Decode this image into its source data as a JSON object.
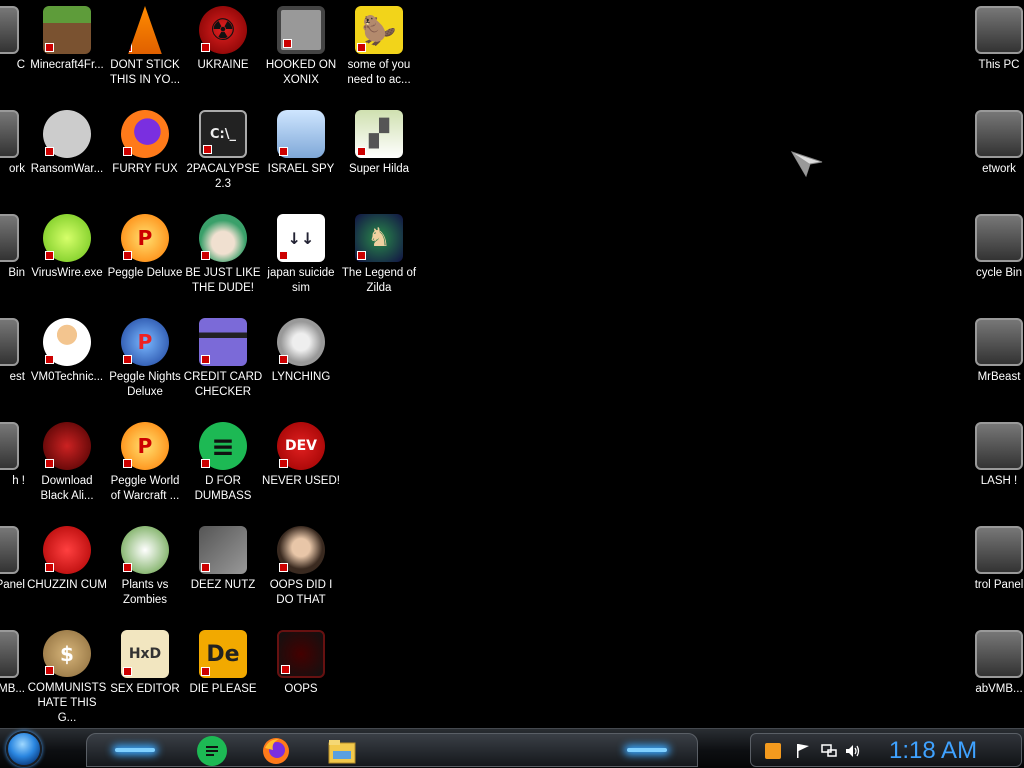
{
  "desktop": {
    "left_edge_labels": [
      "C",
      "ork",
      "Bin",
      "est",
      "h !",
      "Panel",
      "VMB..."
    ],
    "right_edge_labels": [
      "This PC",
      "etwork",
      "cycle Bin",
      "MrBeast",
      "LASH !",
      "trol Panel",
      "abVMB..."
    ],
    "columns": [
      [
        {
          "label": "Minecraft4Fr...",
          "icon": "minecraft-block-icon"
        },
        {
          "label": "RansomWar...",
          "icon": "skull-icon"
        },
        {
          "label": "VirusWire.exe",
          "icon": "lime-icon"
        },
        {
          "label": "VM0Technic...",
          "icon": "technician-icon"
        },
        {
          "label": "Download Black Ali...",
          "icon": "alien-icon"
        },
        {
          "label": "CHUZZIN CUM",
          "icon": "chuzzle-icon"
        },
        {
          "label": "COMMUNISTS HATE THIS G...",
          "icon": "money-bag-icon"
        }
      ],
      [
        {
          "label": "DONT STICK THIS IN YO...",
          "icon": "traffic-cone-icon"
        },
        {
          "label": "FURRY FUX",
          "icon": "firefox-icon"
        },
        {
          "label": "Peggle Deluxe",
          "icon": "peggle-icon"
        },
        {
          "label": "Peggle Nights Deluxe",
          "icon": "peggle-nights-icon"
        },
        {
          "label": "Peggle World of Warcraft ...",
          "icon": "peggle-wow-icon"
        },
        {
          "label": "Plants vs Zombies",
          "icon": "flower-icon"
        },
        {
          "label": "SEX EDITOR",
          "icon": "hex-editor-icon"
        }
      ],
      [
        {
          "label": "UKRAINE",
          "icon": "radiation-icon"
        },
        {
          "label": "2PACALYPSE 2.3",
          "icon": "terminal-icon"
        },
        {
          "label": "BE JUST LIKE THE DUDE!",
          "icon": "santa-globe-icon"
        },
        {
          "label": "CREDIT CARD CHECKER",
          "icon": "credit-card-icon"
        },
        {
          "label": "D FOR DUMBASS",
          "icon": "green-chat-icon"
        },
        {
          "label": "DEEZ NUTZ",
          "icon": "stacked-windows-icon"
        },
        {
          "label": "DIE PLEASE",
          "icon": "die-logo-icon"
        }
      ],
      [
        {
          "label": "HOOKED ON XONIX",
          "icon": "xonix-icon"
        },
        {
          "label": "ISRAEL SPY",
          "icon": "network-spy-icon"
        },
        {
          "label": "japan suicide sim",
          "icon": "document-icon"
        },
        {
          "label": "LYNCHING",
          "icon": "rope-icon"
        },
        {
          "label": "NEVER USED!",
          "icon": "dev-cpp-icon"
        },
        {
          "label": "OOPS DID I DO THAT",
          "icon": "portrait-icon"
        },
        {
          "label": "OOPS",
          "icon": "dark-app-icon"
        }
      ],
      [
        {
          "label": "some of you need to ac...",
          "icon": "beaver-icon"
        },
        {
          "label": "Super Hilda",
          "icon": "pixel-cat-icon"
        },
        {
          "label": "The Legend of Zilda",
          "icon": "pixel-hero-icon"
        }
      ]
    ]
  },
  "taskbar": {
    "start_icon": "start-orb-icon",
    "dock_apps": [
      {
        "name": "green-chat-icon",
        "color": "#1db954"
      },
      {
        "name": "firefox-icon",
        "color": "#ff7a1a"
      },
      {
        "name": "file-explorer-icon",
        "color": "#f2c94c"
      }
    ],
    "tray_icons": [
      "app-tray-icon",
      "flag-icon",
      "network-icon",
      "volume-icon"
    ],
    "clock": "1:18 AM",
    "clock_color": "#3fa2ff"
  }
}
